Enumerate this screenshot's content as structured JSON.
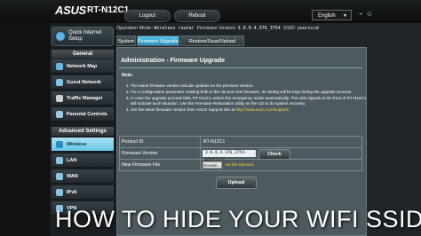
{
  "header": {
    "brand": "ASUS",
    "model": "RT-N12C1",
    "logout_label": "Logout",
    "reboot_label": "Reboot",
    "language": "English"
  },
  "infobar": {
    "op_mode_label": "Operation Mode:",
    "op_mode_value": "Wireless router",
    "fw_label": "Firmware Version:",
    "fw_value": "3.0.0.4.376_3754",
    "ssid_label": "SSID:",
    "ssid_value": "yourssid"
  },
  "sidebar": {
    "quick_setup_label": "Quick Internet Setup",
    "general_label": "General",
    "general_items": [
      {
        "label": "Network Map"
      },
      {
        "label": "Guest Network"
      },
      {
        "label": "Traffic Manager"
      },
      {
        "label": "Parental Controls"
      }
    ],
    "advanced_label": "Advanced Settings",
    "advanced_items": [
      {
        "label": "Wireless"
      },
      {
        "label": "LAN"
      },
      {
        "label": "WAN"
      },
      {
        "label": "IPv6"
      },
      {
        "label": "VPN"
      }
    ]
  },
  "tabs": [
    "System",
    "Firmware Upgrade",
    "Restore/Save/Upload Setting"
  ],
  "panel": {
    "title": "Administration - Firmware Upgrade",
    "note_label": "Note:",
    "notes": [
      "The latest firmware version include updates on the previous version.",
      "For a configuration parameter existing both in the old and new firmware, its setting will be kept during the upgrade process.",
      "In case the upgrade process fails, RT-N12C1 enters the emergency mode automatically. The LED signals at the front of RT-N12C1 will indicate such situation. Use the Firmware Restoration utility on the CD to do system recovery.",
      "Get the latest firmware version from ASUS Support site at"
    ],
    "support_link": "http://www.asus.com/support/",
    "product_id_label": "Product ID",
    "product_id_value": "RT-N12C1",
    "fw_version_label": "Firmware Version",
    "fw_version_value": "3.0.0.4.376_3754-g5ef7c1f",
    "check_label": "Check",
    "new_fw_label": "New Firmware File",
    "browse_label": "Browse...",
    "no_file_label": "No file selected.",
    "upload_label": "Upload"
  },
  "overlay": {
    "text": "HOW TO HIDE YOUR WIFI SSID"
  },
  "colors": {
    "accent": "#59c6ee",
    "selected_menu": "#8fd6ef",
    "panel_bg": "#4d5a60",
    "link": "#ffd24a"
  }
}
